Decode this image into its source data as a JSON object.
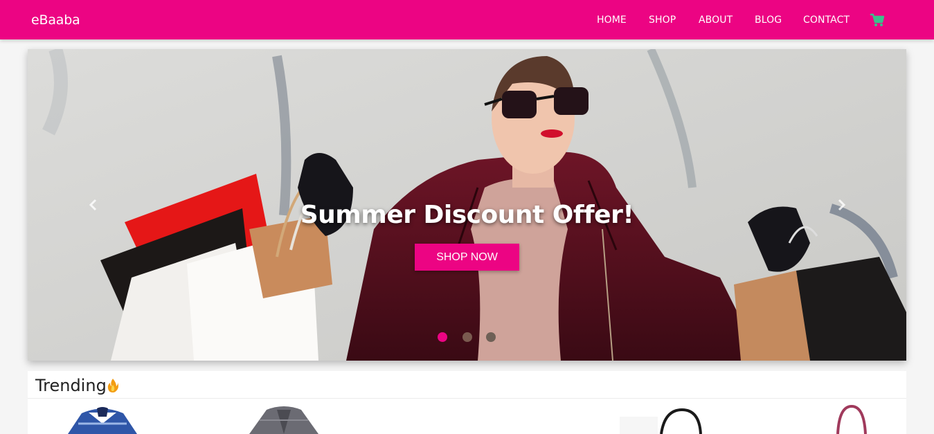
{
  "brand": "eBaaba",
  "nav": {
    "items": [
      "HOME",
      "SHOP",
      "ABOUT",
      "BLOG",
      "CONTACT"
    ],
    "cart_icon": "shopping-cart-icon"
  },
  "carousel": {
    "caption": "Summer Discount Offer!",
    "button_label": "SHOP NOW",
    "slides_count": 3,
    "active_slide": 1,
    "prev_icon": "chevron-left-icon",
    "next_icon": "chevron-right-icon"
  },
  "trending": {
    "title": "Trending",
    "icon": "fire-icon"
  },
  "colors": {
    "brand_pink": "#ec0483",
    "cart_green": "#3bbf8c",
    "background": "#f5f5f5"
  }
}
